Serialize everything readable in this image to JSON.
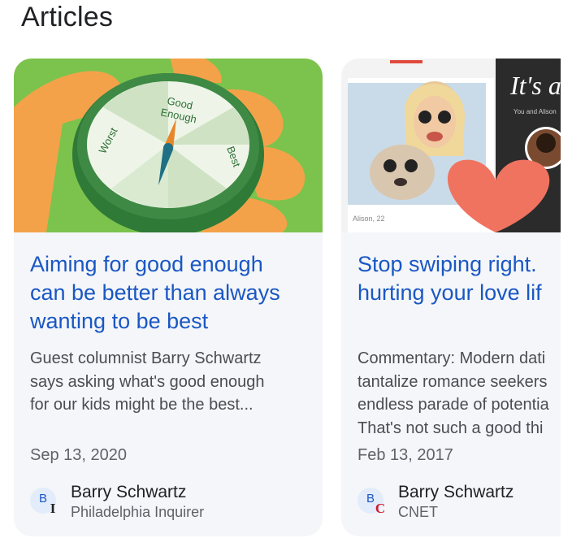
{
  "section": {
    "title": "Articles"
  },
  "articles": [
    {
      "headline": "Aiming for good enough\ncan be better than always\nwanting to be best",
      "snippet": "Guest columnist Barry Schwartz\nsays asking what's good enough\nfor our kids might be the best...",
      "date": "Sep 13, 2020",
      "author": "Barry Schwartz",
      "author_initial": "B",
      "publisher": "Philadelphia Inquirer",
      "publisher_badge": "I",
      "image_text": {
        "top": "Good",
        "top2": "Enough",
        "left": "Worst",
        "right": "Best"
      }
    },
    {
      "headline": "Stop swiping right.\nhurting your love lif",
      "snippet": "Commentary: Modern dati\ntantalize romance seekers\nendless parade of potentia\nThat's not such a good thi",
      "date": "Feb 13, 2017",
      "author": "Barry Schwartz",
      "author_initial": "B",
      "publisher": "CNET",
      "publisher_badge": "C",
      "image_text": {
        "heading": "It's a",
        "sub": "You and Alison",
        "profile": "Alison, 22"
      }
    }
  ],
  "colors": {
    "headline": "#1a57c4",
    "card_bg": "#f4f6f9",
    "compass_green": "#3e8a45",
    "heart": "#f07360"
  }
}
